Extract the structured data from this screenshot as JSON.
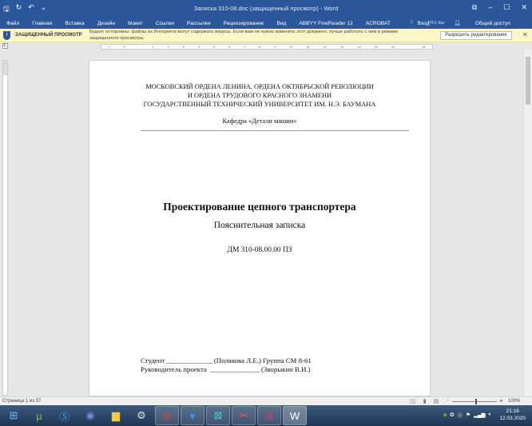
{
  "window": {
    "title": "Записка 310-08.doc (защищенный просмотр) - Word"
  },
  "ribbon": {
    "tabs": [
      "Файл",
      "Главная",
      "Вставка",
      "Дизайн",
      "Макет",
      "Ссылки",
      "Рассылки",
      "Рецензирование",
      "Вид",
      "ABBYY FineReader 12",
      "ACROBAT"
    ],
    "tell_me": "Что вы хотите сделать?",
    "signin": "Вход",
    "share": "Общий доступ"
  },
  "protected_view": {
    "label": "ЗАЩИЩЕННЫЙ ПРОСМОТР",
    "message": "Будьте осторожны: файлы из Интернета могут содержать вирусы. Если вам не нужно изменять этот документ, лучше работать с ним в режиме защищенного просмотра.",
    "enable_button": "Разрешить редактирование"
  },
  "ruler": {
    "ticks": [
      "2",
      "1",
      "",
      "1",
      "2",
      "3",
      "4",
      "5",
      "6",
      "7",
      "8",
      "9",
      "10",
      "11",
      "12",
      "13",
      "14",
      "15",
      "16",
      "",
      "18"
    ]
  },
  "document": {
    "header_lines": [
      "МОСКОВСКИЙ ОРДЕНА ЛЕНИНА, ОРДЕНА ОКТЯБРЬСКОЙ РЕВОЛЮЦИИ",
      "И ОРДЕНА ТРУДОВОГО КРАСНОГО ЗНАМЕНИ",
      "ГОСУДАРСТВЕННЫЙ ТЕХНИЧЕСКИЙ УНИВЕРСИТЕТ ИМ. Н.Э. БАУМАНА"
    ],
    "department": "Кафедра «Детали машин»",
    "title": "Проектирование цепного транспортера",
    "subtitle": "Пояснительная записка",
    "code": "ДМ 310-08.00.00 ПЗ",
    "student_line": "Студент _____________ (Полякова Л.Е.) Группа СМ 8-61",
    "supervisor_line": "Руководитель проекта  ______________ (Зворыкин В.И.)"
  },
  "status": {
    "page": "Страница 1 из 37",
    "zoom": "100%"
  },
  "taskbar": {
    "time": "21:16",
    "date": "12.03.2020"
  }
}
